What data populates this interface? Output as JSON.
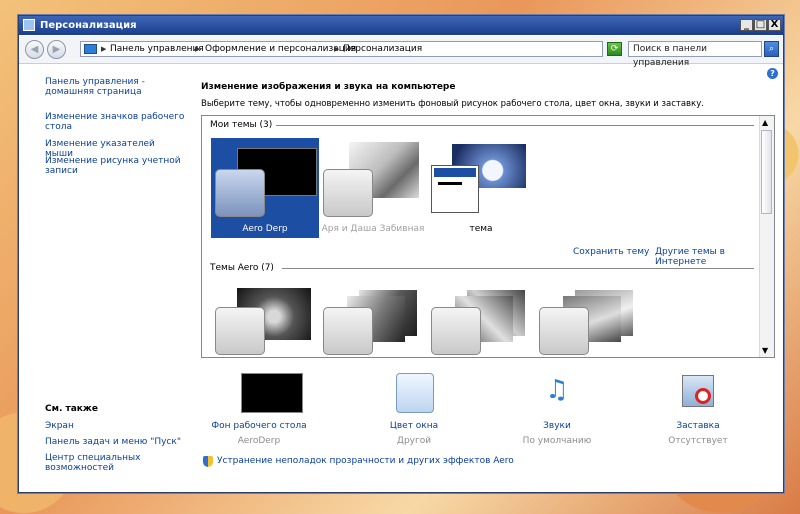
{
  "window": {
    "title": "Персонализация",
    "controls": [
      "_",
      "□",
      "X"
    ]
  },
  "address": {
    "crumbs": [
      "Панель управления",
      "Оформление и персонализация",
      "Персонализация"
    ],
    "search_placeholder": "Поиск в панели управления"
  },
  "sidebar": {
    "items": [
      "Панель управления - домашняя страница",
      "Изменение значков рабочего стола",
      "Изменение указателей мыши",
      "Изменение рисунка учетной записи"
    ],
    "see_also_header": "См. также",
    "see_also": [
      "Экран",
      "Панель задач и меню \"Пуск\"",
      "Центр специальных возможностей"
    ]
  },
  "main": {
    "title": "Изменение изображения и звука на компьютере",
    "subtitle": "Выберите тему, чтобы одновременно изменить фоновый рисунок рабочего стола, цвет окна, звуки и заставку.",
    "my_themes_header": "Мои темы (3)",
    "my_themes": [
      {
        "name": "Aero Derp",
        "selected": true
      },
      {
        "name": "Аря и Даша Забивная",
        "selected": false
      },
      {
        "name": "тема",
        "selected": false
      }
    ],
    "save_theme": "Сохранить тему",
    "more_themes": "Другие темы в Интернете",
    "aero_header": "Темы Aero (7)"
  },
  "bottom": [
    {
      "label": "Фон рабочего стола",
      "value": "AeroDerp",
      "icon": "desktop-background-icon"
    },
    {
      "label": "Цвет окна",
      "value": "Другой",
      "icon": "window-color-icon"
    },
    {
      "label": "Звуки",
      "value": "По умолчанию",
      "icon": "sounds-icon"
    },
    {
      "label": "Заставка",
      "value": "Отсутствует",
      "icon": "screensaver-icon"
    }
  ],
  "troubleshoot": "Устранение неполадок прозрачности и других эффектов Aero",
  "colors": {
    "titlebar": "#1a3d8c",
    "link": "#0a3f9e",
    "selected": "#1c4ea3"
  }
}
